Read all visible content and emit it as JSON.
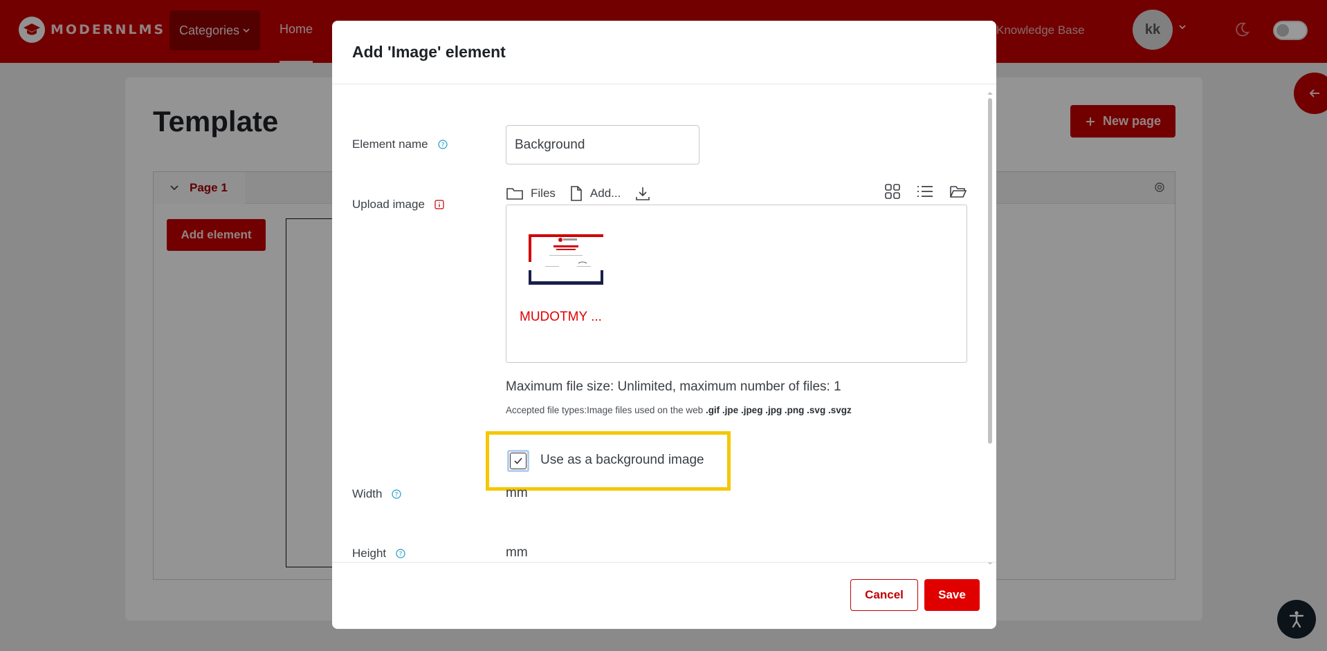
{
  "navbar": {
    "logo_text": "MODERNLMS",
    "categories_label": "Categories",
    "home_label": "Home",
    "right_link_label": "Knowledge Base",
    "avatar_initials": "kk"
  },
  "page": {
    "title": "Template",
    "new_page_label": "New page",
    "page_tab_label": "Page 1",
    "add_element_label": "Add element"
  },
  "modal": {
    "title": "Add 'Image' element",
    "element_name_label": "Element name",
    "element_name_value": "Background",
    "upload_image_label": "Upload image",
    "filepicker": {
      "files_label": "Files",
      "add_label": "Add...",
      "file_name": "MUDOTMY ...",
      "limit_text": "Maximum file size: Unlimited, maximum number of files: 1",
      "types_prefix": "Accepted file types:Image files used on the web",
      "types_list": ".gif .jpe .jpeg .jpg .png .svg .svgz"
    },
    "background_checkbox_label": "Use as a background image",
    "background_checked": true,
    "width_label": "Width",
    "width_unit": "mm",
    "height_label": "Height",
    "height_unit": "mm",
    "cancel_label": "Cancel",
    "save_label": "Save"
  },
  "colors": {
    "brand": "#c00000",
    "highlight": "#f5c800",
    "save": "#e00000"
  }
}
